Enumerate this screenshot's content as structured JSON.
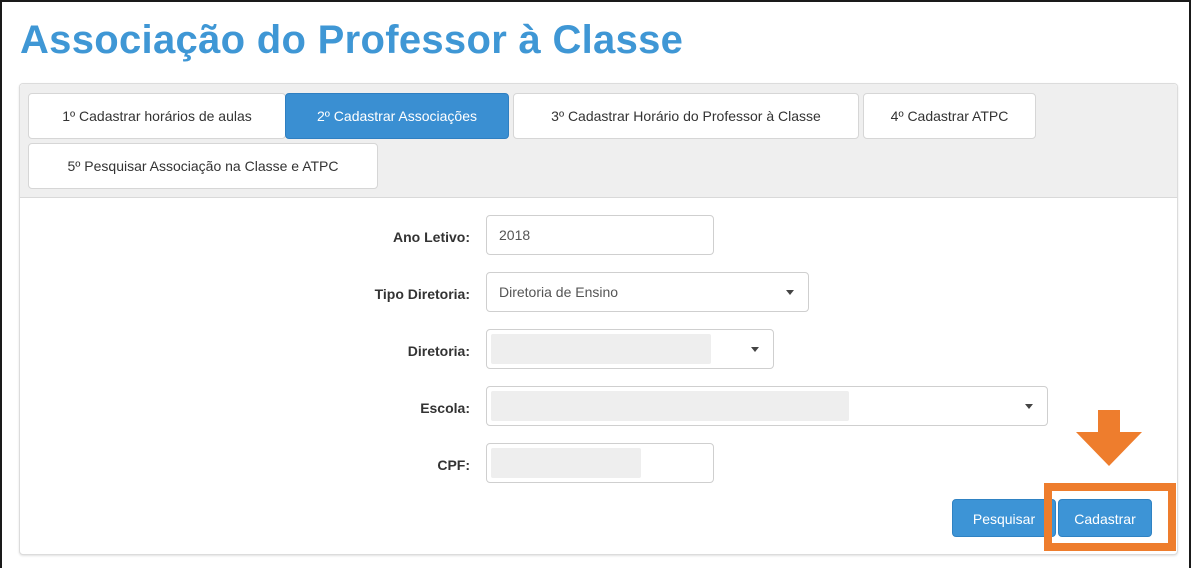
{
  "page": {
    "title": "Associação do Professor à Classe"
  },
  "tabs": [
    {
      "label": "1º Cadastrar horários de aulas",
      "active": false
    },
    {
      "label": "2º Cadastrar Associações",
      "active": true
    },
    {
      "label": "3º Cadastrar Horário do Professor à Classe",
      "active": false
    },
    {
      "label": "4º Cadastrar ATPC",
      "active": false
    },
    {
      "label": "5º Pesquisar Associação na Classe e ATPC",
      "active": false
    }
  ],
  "form": {
    "ano_letivo": {
      "label": "Ano Letivo:",
      "value": "2018"
    },
    "tipo_diretoria": {
      "label": "Tipo Diretoria:",
      "value": "Diretoria de Ensino"
    },
    "diretoria": {
      "label": "Diretoria:",
      "value": ""
    },
    "escola": {
      "label": "Escola:",
      "value": ""
    },
    "cpf": {
      "label": "CPF:",
      "value": ""
    }
  },
  "actions": {
    "search_label": "Pesquisar",
    "register_label": "Cadastrar"
  },
  "colors": {
    "title": "#3f97d5",
    "active_tab": "#3a8fd2",
    "button": "#3d94d6",
    "highlight": "#ee7d2d"
  },
  "icons": {
    "dropdown": "chevron-down-icon",
    "annotation": "arrow-down-icon"
  }
}
